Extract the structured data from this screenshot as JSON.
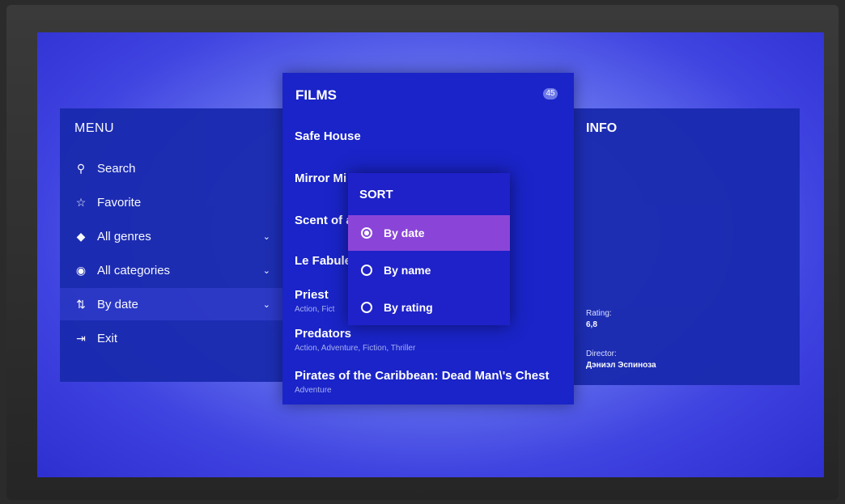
{
  "menu": {
    "title": "MENU",
    "items": [
      {
        "label": "Search",
        "icon": "search-icon",
        "glyph": "⚲",
        "has_dropdown": false
      },
      {
        "label": "Favorite",
        "icon": "star-icon",
        "glyph": "☆",
        "has_dropdown": false
      },
      {
        "label": "All genres",
        "icon": "genres-icon",
        "glyph": "◆",
        "has_dropdown": true
      },
      {
        "label": "All categories",
        "icon": "categories-icon",
        "glyph": "◉",
        "has_dropdown": true
      },
      {
        "label": "By date",
        "icon": "sort-icon",
        "glyph": "⇅",
        "has_dropdown": true
      },
      {
        "label": "Exit",
        "icon": "exit-icon",
        "glyph": "⇥",
        "has_dropdown": false
      }
    ],
    "chevron": "⌄"
  },
  "films": {
    "title": "FILMS",
    "count": "45",
    "items": [
      {
        "title": "Safe House",
        "genres": ""
      },
      {
        "title": "Mirror Mi",
        "genres": ""
      },
      {
        "title": "Scent of a",
        "genres": ""
      },
      {
        "title": "Le Fabule",
        "genres": ""
      },
      {
        "title": "Priest",
        "genres": "Action, Fict"
      },
      {
        "title": "Predators",
        "genres": "Action, Adventure, Fiction, Thriller"
      },
      {
        "title": "Pirates of the Caribbean: Dead Man\\'s Chest",
        "genres": "Adventure"
      }
    ]
  },
  "sort": {
    "title": "SORT",
    "options": [
      {
        "label": "By date",
        "selected": true
      },
      {
        "label": "By name",
        "selected": false
      },
      {
        "label": "By rating",
        "selected": false
      }
    ]
  },
  "info": {
    "title": "INFO",
    "rating_label": "Rating:",
    "rating_value": "6,8",
    "director_label": "Director:",
    "director_value": "Дэниэл Эспиноза"
  }
}
